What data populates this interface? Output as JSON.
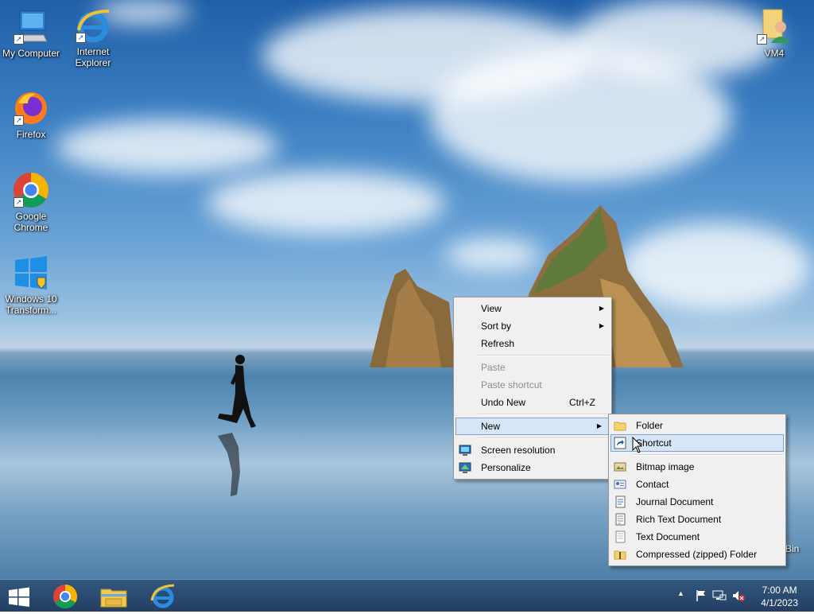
{
  "desktop": {
    "icons": [
      {
        "label": "My Computer",
        "icon": "computer-icon"
      },
      {
        "label": "Internet\nExplorer",
        "icon": "internet-explorer-icon"
      },
      {
        "label": "Firefox",
        "icon": "firefox-icon"
      },
      {
        "label": "Google\nChrome",
        "icon": "chrome-icon"
      },
      {
        "label": "Windows 10\nTransform...",
        "icon": "windows-icon"
      },
      {
        "label": "VM4",
        "icon": "user-folder-icon"
      }
    ],
    "recycle_bin_partial_label": "Bin"
  },
  "context_menu": {
    "items": [
      {
        "label": "View",
        "submenu": true
      },
      {
        "label": "Sort by",
        "submenu": true
      },
      {
        "label": "Refresh"
      },
      {
        "label": "Paste",
        "disabled": true
      },
      {
        "label": "Paste shortcut",
        "disabled": true
      },
      {
        "label": "Undo New",
        "shortcut": "Ctrl+Z"
      },
      {
        "label": "New",
        "submenu": true
      },
      {
        "label": "Screen resolution",
        "icon": "monitor-icon"
      },
      {
        "label": "Personalize",
        "icon": "personalize-icon"
      }
    ]
  },
  "new_submenu": {
    "items": [
      {
        "label": "Folder",
        "icon": "folder-icon"
      },
      {
        "label": "Shortcut",
        "icon": "shortcut-icon"
      },
      {
        "label": "Bitmap image",
        "icon": "bitmap-icon"
      },
      {
        "label": "Contact",
        "icon": "contact-icon"
      },
      {
        "label": "Journal Document",
        "icon": "journal-icon"
      },
      {
        "label": "Rich Text Document",
        "icon": "rtf-icon"
      },
      {
        "label": "Text Document",
        "icon": "text-doc-icon"
      },
      {
        "label": "Compressed (zipped) Folder",
        "icon": "zip-folder-icon"
      }
    ]
  },
  "taskbar": {
    "pinned": [
      "start-button",
      "chrome",
      "file-explorer",
      "internet-explorer"
    ],
    "tray_icons": [
      "show-hidden-icon",
      "action-center-flag-icon",
      "network-icon",
      "volume-muted-icon"
    ],
    "time": "7:00 AM",
    "date": "4/1/2023"
  },
  "colors": {
    "menu_bg": "#f0f0f0",
    "menu_highlight": "#d6e6f7",
    "menu_highlight_border": "#7da2ce",
    "taskbar": "#1c385c"
  }
}
